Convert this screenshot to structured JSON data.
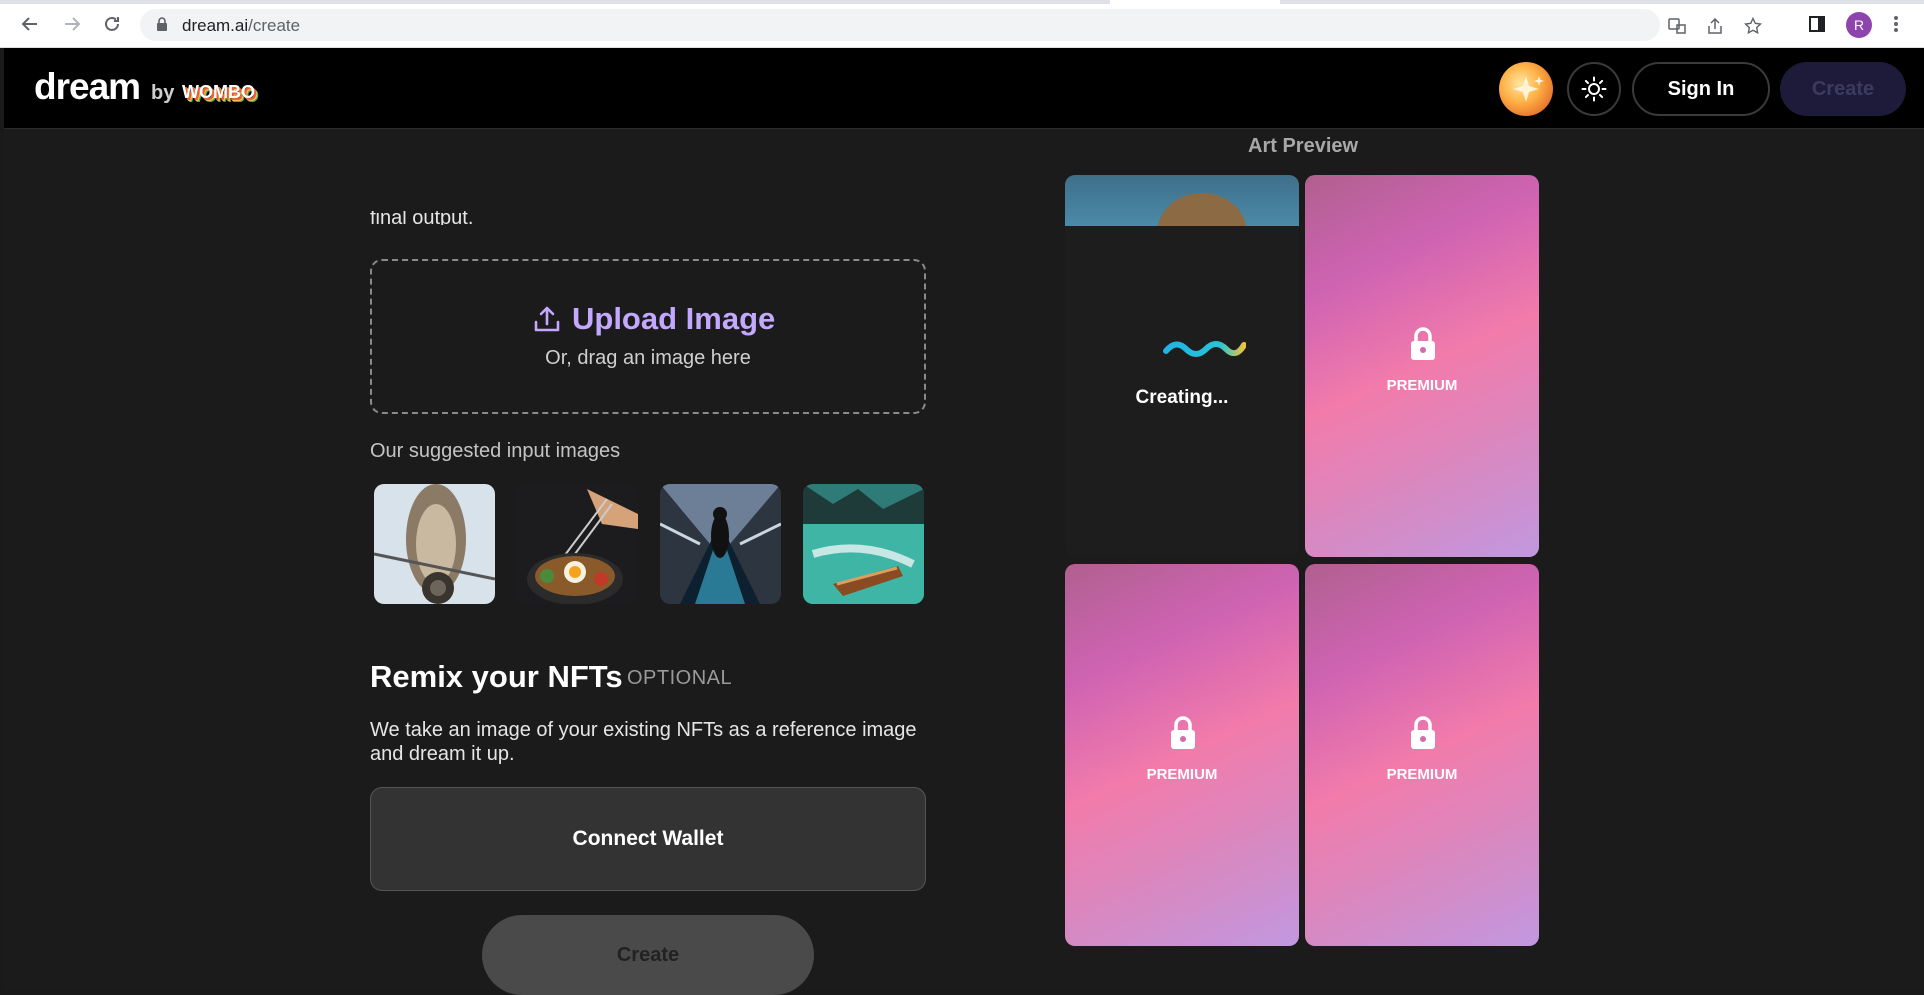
{
  "browser": {
    "url_host": "dream.ai",
    "url_path": "/create",
    "profile_initial": "R"
  },
  "header": {
    "logo": "dream",
    "logo_by": "by",
    "logo_brand": "WOMBO",
    "sign_in": "Sign In",
    "create": "Create"
  },
  "left": {
    "cut_text": "final output.",
    "upload_title": "Upload Image",
    "upload_sub": "Or, drag an image here",
    "suggest_label": "Our suggested input images",
    "thumbs": [
      {
        "name": "owl",
        "icon": "owl-image"
      },
      {
        "name": "ramen",
        "icon": "ramen-image"
      },
      {
        "name": "escalator",
        "icon": "escalator-image"
      },
      {
        "name": "boat",
        "icon": "boat-image"
      }
    ],
    "nft_title": "Remix your NFTs",
    "nft_optional": "OPTIONAL",
    "nft_desc": "We take an image of your existing NFTs as a reference image and dream it up.",
    "connect_wallet": "Connect Wallet",
    "create": "Create"
  },
  "preview": {
    "label": "Art Preview",
    "creating": "Creating...",
    "premium": "PREMIUM"
  },
  "colors": {
    "accent": "#c4a8ff",
    "background": "#1b1b1b",
    "header": "#000000"
  }
}
